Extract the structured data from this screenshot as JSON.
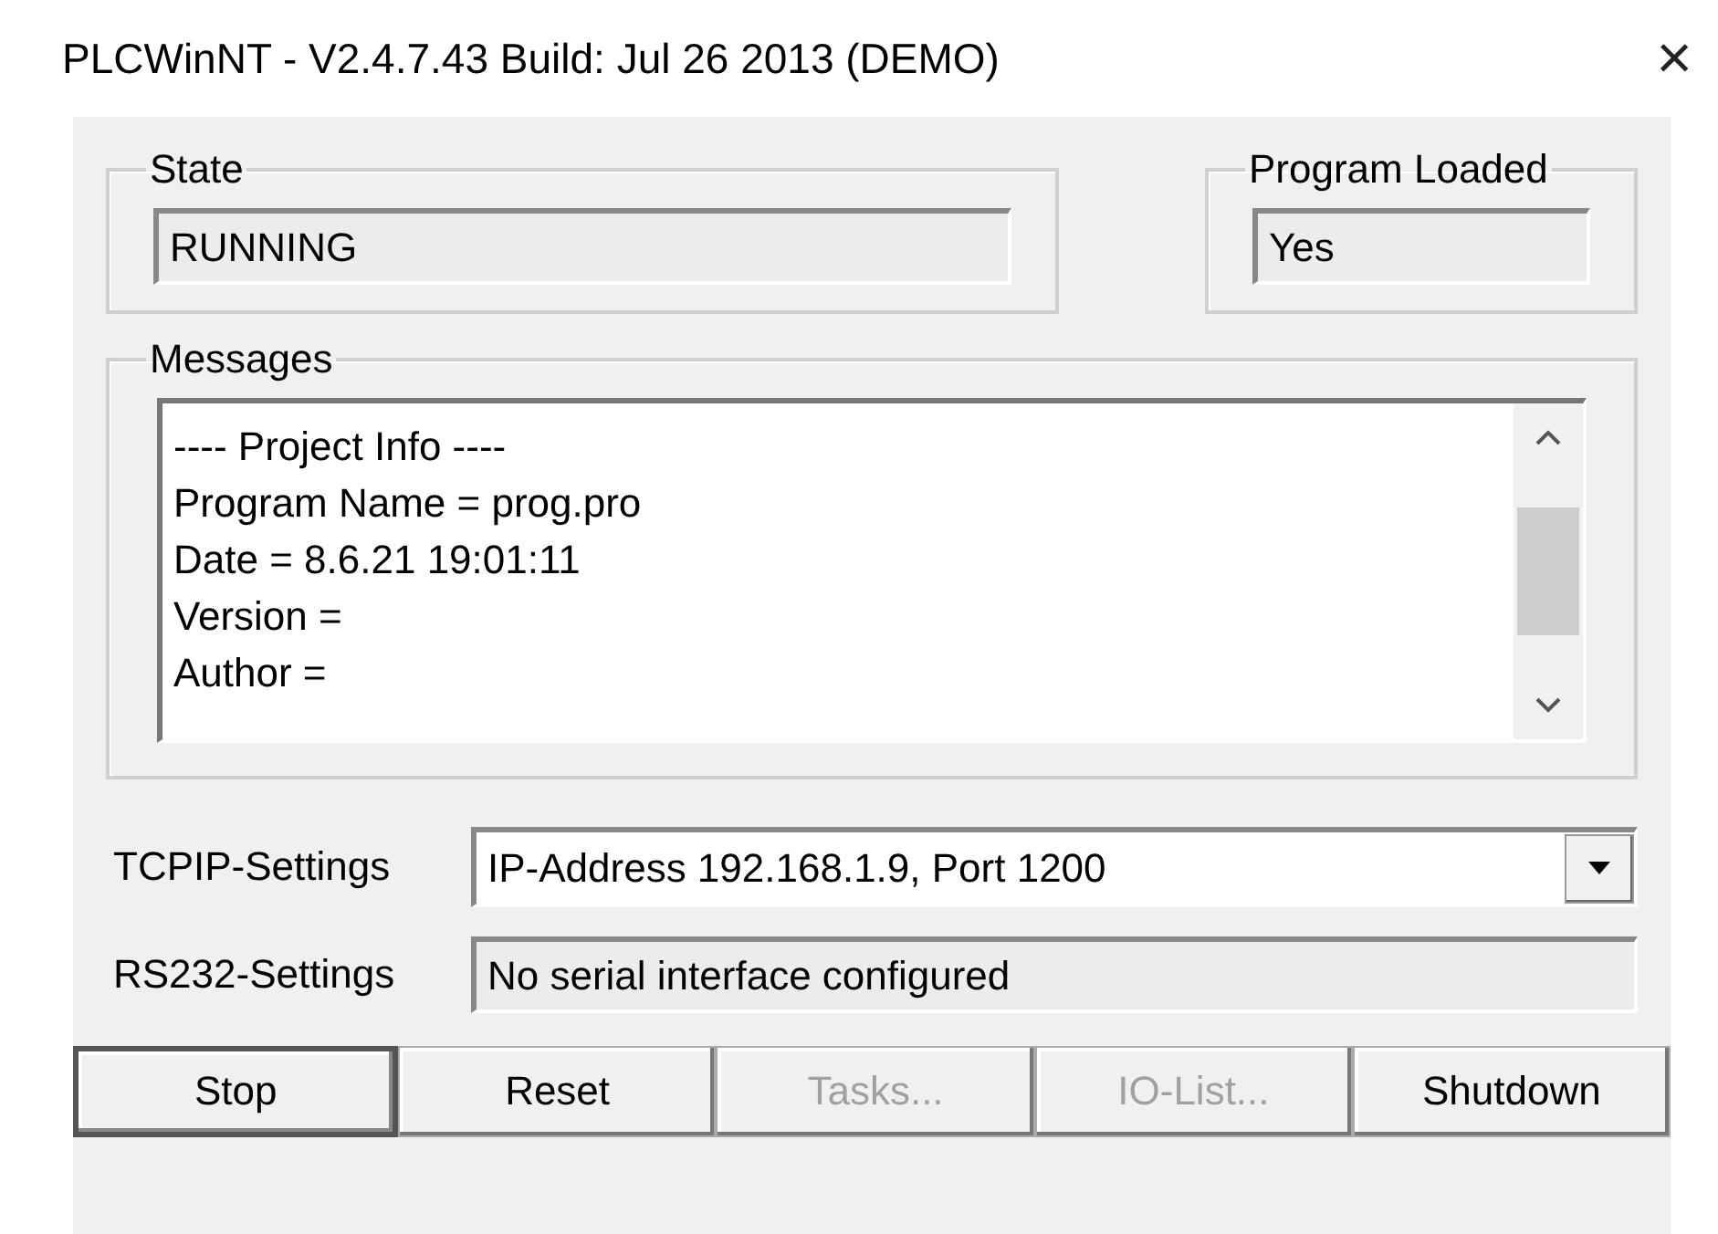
{
  "window": {
    "title": "PLCWinNT - V2.4.7.43  Build: Jul 26 2013 (DEMO)",
    "close": "×"
  },
  "state": {
    "label": "State",
    "value": "RUNNING"
  },
  "program_loaded": {
    "label": "Program Loaded",
    "value": "Yes"
  },
  "messages": {
    "label": "Messages",
    "lines": [
      "---- Project Info ----",
      "Program Name = prog.pro",
      "Date = 8.6.21 19:01:11",
      "Version =",
      "Author ="
    ]
  },
  "settings": [
    {
      "kind": "dropdown",
      "label": "TCPIP-Settings",
      "value": "IP-Address 192.168.1.9, Port 1200"
    },
    {
      "kind": "readonly",
      "label": "RS232-Settings",
      "value": "No serial interface configured"
    }
  ],
  "buttons": [
    {
      "label": "Stop",
      "disabled": false,
      "default": true
    },
    {
      "label": "Reset",
      "disabled": false,
      "default": false
    },
    {
      "label": "Tasks...",
      "disabled": true,
      "default": false
    },
    {
      "label": "IO-List...",
      "disabled": true,
      "default": false
    },
    {
      "label": "Shutdown",
      "disabled": false,
      "default": false
    }
  ]
}
